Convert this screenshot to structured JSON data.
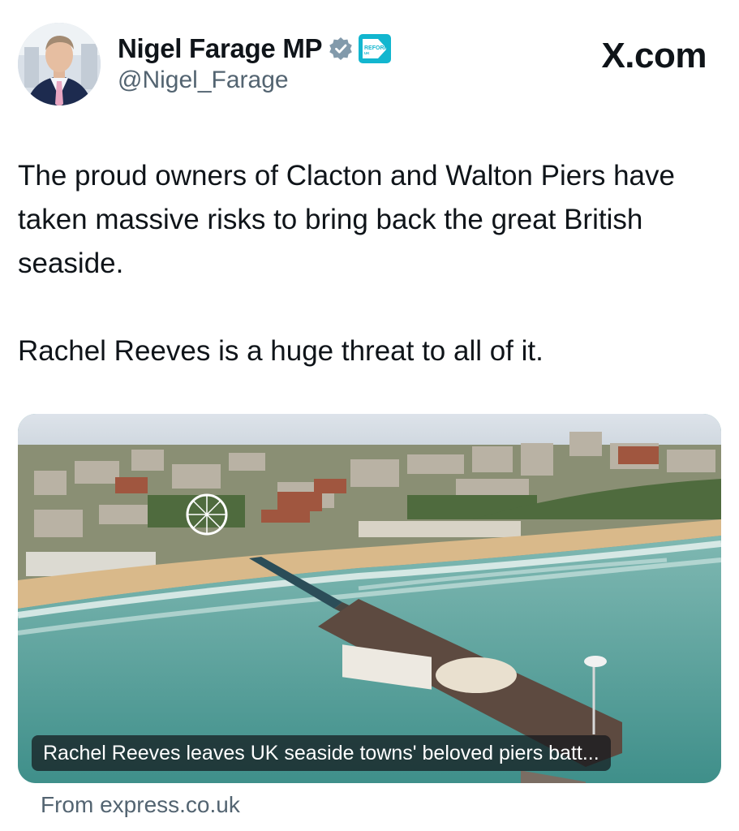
{
  "author": {
    "display_name": "Nigel Farage MP",
    "handle": "@Nigel_Farage",
    "verified_icon": "verified-badge-icon",
    "affiliation_badge_text": "REFORM UK",
    "affiliation_badge_color": "#12b6cf"
  },
  "brand": {
    "site": "X.com"
  },
  "tweet": {
    "paragraph_1": "The proud owners of Clacton and Walton Piers have taken massive risks to bring back the great British seaside.",
    "paragraph_2": "Rachel Reeves is a huge threat to all of it."
  },
  "link_card": {
    "caption": "Rachel Reeves leaves UK seaside towns' beloved piers batt...",
    "source": "From express.co.uk"
  }
}
